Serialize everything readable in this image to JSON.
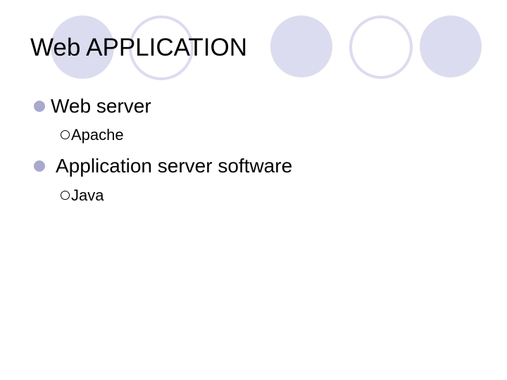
{
  "slide": {
    "title": "Web APPLICATION",
    "bullets": [
      {
        "label": "Web server",
        "sub": [
          "Apache"
        ]
      },
      {
        "label": "Application server software",
        "sub": [
          "Java"
        ]
      }
    ]
  },
  "colors": {
    "decor_circle": "#dcdcf0",
    "bullet_dot": "#a9a9ce",
    "text": "#000000"
  },
  "icons": {
    "level1_bullet": "filled-circle-icon",
    "level2_bullet": "hollow-circle-icon"
  }
}
